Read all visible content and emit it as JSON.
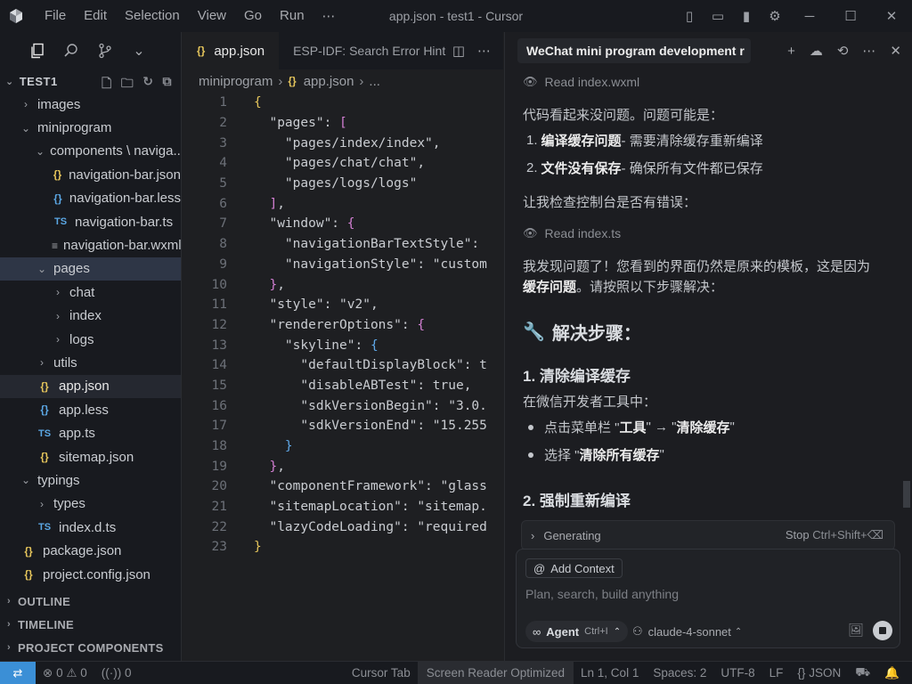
{
  "titlebar": {
    "menu": [
      "File",
      "Edit",
      "Selection",
      "View",
      "Go",
      "Run",
      "⋯"
    ],
    "title": "app.json - test1 - Cursor"
  },
  "sidebar": {
    "project": "TEST1",
    "tree": [
      {
        "label": "images",
        "type": "folder",
        "state": "closed",
        "depth": 1
      },
      {
        "label": "miniprogram",
        "type": "folder",
        "state": "open",
        "depth": 1
      },
      {
        "label": "components \\ naviga...",
        "type": "folder",
        "state": "open",
        "depth": 2
      },
      {
        "label": "navigation-bar.json",
        "type": "json",
        "depth": 3
      },
      {
        "label": "navigation-bar.less",
        "type": "less",
        "depth": 3
      },
      {
        "label": "navigation-bar.ts",
        "type": "ts",
        "depth": 3
      },
      {
        "label": "navigation-bar.wxml",
        "type": "wxml",
        "depth": 3
      },
      {
        "label": "pages",
        "type": "folder",
        "state": "open",
        "depth": 2,
        "selected": true
      },
      {
        "label": "chat",
        "type": "folder",
        "state": "closed",
        "depth": 3
      },
      {
        "label": "index",
        "type": "folder",
        "state": "closed",
        "depth": 3
      },
      {
        "label": "logs",
        "type": "folder",
        "state": "closed",
        "depth": 3
      },
      {
        "label": "utils",
        "type": "folder",
        "state": "closed",
        "depth": 2
      },
      {
        "label": "app.json",
        "type": "json",
        "depth": 2,
        "current": true
      },
      {
        "label": "app.less",
        "type": "less",
        "depth": 2
      },
      {
        "label": "app.ts",
        "type": "ts",
        "depth": 2
      },
      {
        "label": "sitemap.json",
        "type": "json",
        "depth": 2
      },
      {
        "label": "typings",
        "type": "folder",
        "state": "open",
        "depth": 1
      },
      {
        "label": "types",
        "type": "folder",
        "state": "closed",
        "depth": 2
      },
      {
        "label": "index.d.ts",
        "type": "ts",
        "depth": 2
      },
      {
        "label": "package.json",
        "type": "json",
        "depth": 1
      },
      {
        "label": "project.config.json",
        "type": "json",
        "depth": 1
      }
    ],
    "sections": [
      "OUTLINE",
      "TIMELINE",
      "PROJECT COMPONENTS"
    ]
  },
  "editor": {
    "tabs": [
      {
        "label": "app.json",
        "active": true
      },
      {
        "label": "ESP-IDF: Search Error Hint",
        "active": false
      }
    ],
    "breadcrumb": [
      "miniprogram",
      "app.json",
      "..."
    ],
    "lines": [
      "{",
      "  \"pages\": [",
      "    \"pages/index/index\",",
      "    \"pages/chat/chat\",",
      "    \"pages/logs/logs\"",
      "  ],",
      "  \"window\": {",
      "    \"navigationBarTextStyle\":",
      "    \"navigationStyle\": \"custom",
      "  },",
      "  \"style\": \"v2\",",
      "  \"rendererOptions\": {",
      "    \"skyline\": {",
      "      \"defaultDisplayBlock\": t",
      "      \"disableABTest\": true,",
      "      \"sdkVersionBegin\": \"3.0.",
      "      \"sdkVersionEnd\": \"15.255",
      "    }",
      "  },",
      "  \"componentFramework\": \"glass",
      "  \"sitemapLocation\": \"sitemap.",
      "  \"lazyCodeLoading\": \"required",
      "}"
    ]
  },
  "chat": {
    "title": "WeChat mini program development r",
    "read1": "Read index.wxml",
    "p1": "代码看起来没问题。问题可能是：",
    "item1_strong": "编译缓存问题",
    "item1_rest": " - 需要清除缓存重新编译",
    "item2_strong": "文件没有保存",
    "item2_rest": " - 确保所有文件都已保存",
    "p2": "让我检查控制台是否有错误：",
    "read2": "Read index.ts",
    "p3a": "我发现问题了！您看到的界面仍然是原来的模板，这是因为",
    "p3b_strong": "缓存问题",
    "p3b_rest": "。请按照以下步骤解决：",
    "h3": "解决步骤：",
    "h4a": "1. 清除编译缓存",
    "p4": "在微信开发者工具中：",
    "b1_pre": "点击菜单栏 \"",
    "b1_s1": "工具",
    "b1_mid": "\" → \"",
    "b1_s2": "清除缓存",
    "b1_post": "\"",
    "b2_pre": "选择 \"",
    "b2_s": "清除所有缓存",
    "b2_post": "\"",
    "h4b": "2. 强制重新编译",
    "generating": "Generating",
    "stop": "Stop",
    "stop_kbd": "Ctrl+Shift+⌫",
    "add_context": "Add Context",
    "placeholder": "Plan, search, build anything",
    "agent": "Agent",
    "agent_kbd": "Ctrl+I",
    "model": "claude-4-sonnet"
  },
  "statusbar": {
    "errors": "0",
    "warnings": "0",
    "ports": "0",
    "cursor_tab": "Cursor Tab",
    "screen_reader": "Screen Reader Optimized",
    "position": "Ln 1, Col 1",
    "spaces": "Spaces: 2",
    "encoding": "UTF-8",
    "eol": "LF",
    "language": "JSON"
  },
  "colors": {
    "accent": "#3b8fd6",
    "json_icon": "#e4c45b",
    "ts_icon": "#5ba7e4",
    "bracket_pink": "#d37fd3",
    "bracket_blue": "#5fa8e8"
  }
}
